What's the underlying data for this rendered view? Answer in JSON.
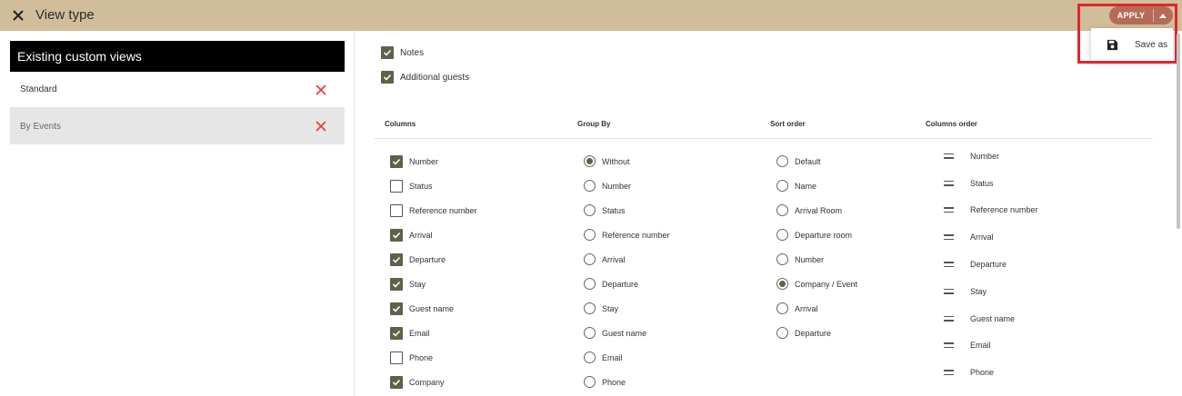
{
  "header": {
    "title": "View type",
    "apply_label": "APPLY",
    "save_as_label": "Save as"
  },
  "views": {
    "heading": "Existing custom views",
    "items": [
      {
        "label": "Standard",
        "selected": false
      },
      {
        "label": "By Events",
        "selected": true
      }
    ]
  },
  "options": [
    {
      "label": "Notes",
      "checked": true
    },
    {
      "label": "Additional guests",
      "checked": true
    }
  ],
  "columns": {
    "heading": "Columns",
    "items": [
      {
        "label": "Number",
        "checked": true
      },
      {
        "label": "Status",
        "checked": false
      },
      {
        "label": "Reference number",
        "checked": false
      },
      {
        "label": "Arrival",
        "checked": true
      },
      {
        "label": "Departure",
        "checked": true
      },
      {
        "label": "Stay",
        "checked": true
      },
      {
        "label": "Guest name",
        "checked": true
      },
      {
        "label": "Email",
        "checked": true
      },
      {
        "label": "Phone",
        "checked": false
      },
      {
        "label": "Company",
        "checked": true
      }
    ]
  },
  "group_by": {
    "heading": "Group By",
    "selected": "Without",
    "items": [
      "Without",
      "Number",
      "Status",
      "Reference number",
      "Arrival",
      "Departure",
      "Stay",
      "Guest name",
      "Email",
      "Phone"
    ]
  },
  "sort_order": {
    "heading": "Sort order",
    "selected": "Company / Event",
    "items": [
      "Default",
      "Name",
      "Arrival Room",
      "Departure room",
      "Number",
      "Company / Event",
      "Arrival",
      "Departure"
    ]
  },
  "columns_order": {
    "heading": "Columns order",
    "items": [
      "Number",
      "Status",
      "Reference number",
      "Arrival",
      "Departure",
      "Stay",
      "Guest name",
      "Email",
      "Phone"
    ]
  },
  "colors": {
    "topbar": "#cfbe99",
    "apply": "#b56b57",
    "checked": "#5b6349",
    "delete": "#e53935",
    "highlight": "#e0262b"
  }
}
